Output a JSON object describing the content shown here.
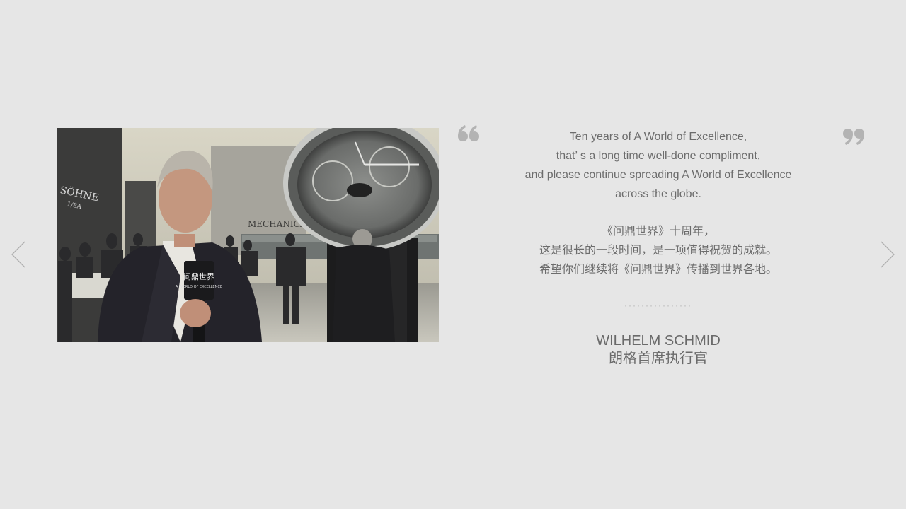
{
  "quote": {
    "en_lines": [
      "Ten years of A World of Excellence,",
      "that’ s a long time well-done compliment,",
      "and please continue spreading A World of Excellence",
      "across the globe."
    ],
    "cn_lines": [
      "《问鼎世界》十周年，",
      "这是很长的一段时间，是一项值得祝贺的成就。",
      "希望你们继续将《问鼎世界》传播到世界各地。"
    ],
    "divider": "················",
    "author_name": "WILHELM SCHMID",
    "author_title": "朗格首席执行官"
  },
  "photo": {
    "wall_text": "MECHANICA",
    "brand_text": "SÖHNE",
    "brand_sub": "1/8A",
    "mic_logo_cn": "问鼎世界",
    "mic_logo_en": "A WORLD OF EXCELLENCE"
  },
  "icons": {
    "prev": "chevron-left-icon",
    "next": "chevron-right-icon",
    "open_quote": "open-quote-icon",
    "close_quote": "close-quote-icon"
  },
  "colors": {
    "background": "#e6e6e6",
    "text": "#6c6c6c",
    "quote_mark": "#b3b3b3",
    "arrow": "#b0b0b0"
  }
}
